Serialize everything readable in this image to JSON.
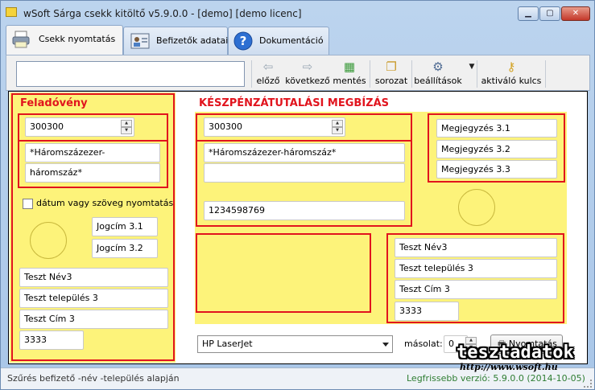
{
  "window": {
    "title": "wSoft Sárga csekk kitöltő v5.9.0.0 - [demo] [demo licenc]"
  },
  "tabs": [
    {
      "label": "Csekk nyomtatás",
      "icon": "printer-icon"
    },
    {
      "label": "Befizetők adatai",
      "icon": "contact-card-icon"
    },
    {
      "label": "Dokumentáció",
      "icon": "help-icon"
    }
  ],
  "toolbar": {
    "search_value": "",
    "prev": "előző",
    "next": "következő",
    "save": "mentés",
    "series": "sorozat",
    "settings": "beállítások",
    "activation": "aktiváló kulcs"
  },
  "sender": {
    "heading": "Feladóvény",
    "amount": "300300",
    "amount_text_1": "*Háromszázezer-",
    "amount_text_2": "háromszáz*",
    "date_option": "dátum vagy szöveg nyomtatás",
    "jogcim_1": "Jogcím 3.1",
    "jogcim_2": "Jogcím 3.2",
    "name": "Teszt Név3",
    "city": "Teszt település 3",
    "address": "Teszt Cím 3",
    "zip": "3333"
  },
  "transfer": {
    "heading": "KÉSZPÉNZÁTUTALÁSI MEGBÍZÁS",
    "amount": "300300",
    "amount_text": "*Háromszázezer-háromszáz*",
    "amount_text_2": "",
    "account": "1234598769",
    "note_1": "Megjegyzés 3.1",
    "note_2": "Megjegyzés 3.2",
    "note_3": "Megjegyzés 3.3",
    "name": "Teszt Név3",
    "city": "Teszt település 3",
    "address": "Teszt Cím 3",
    "zip": "3333"
  },
  "bottom": {
    "printer": "HP LaserJet",
    "copies_label": "másolat:",
    "copies": "0",
    "print": "Nyomtatás"
  },
  "status": {
    "left": "Szűrés befizető -név -település alapján",
    "right": "Legfrissebb verzió: 5.9.0.0 (2014-10-05)"
  },
  "watermark": {
    "text": "tesztadatok",
    "url": "http://www.wsoft.hu"
  },
  "colors": {
    "accent_red": "#e1141e",
    "check_yellow": "#fdf37a",
    "status_green": "#2e7d32"
  }
}
